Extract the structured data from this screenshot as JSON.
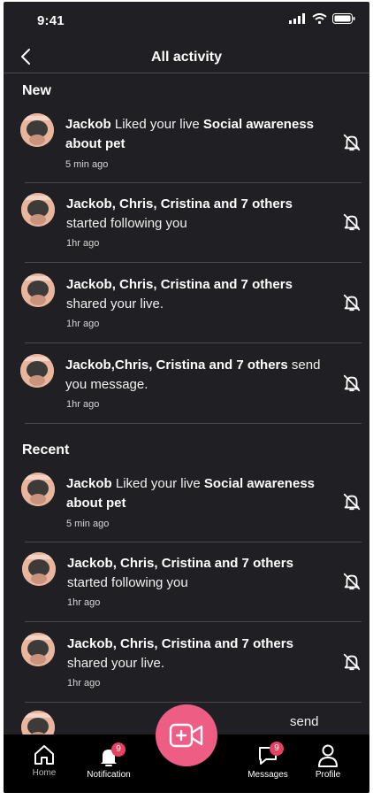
{
  "status": {
    "time": "9:41"
  },
  "header": {
    "title": "All activity"
  },
  "sections": {
    "new": "New",
    "recent": "Recent"
  },
  "items": [
    {
      "a": "Jackob",
      "b": " Liked your live ",
      "c": "Social awareness about pet",
      "d": "",
      "time": "5 min ago"
    },
    {
      "a": "Jackob, Chris, Cristina and 7 others",
      "b": " started following you",
      "c": "",
      "d": "",
      "time": "1hr ago"
    },
    {
      "a": "Jackob, Chris, Cristina and 7 others",
      "b": " shared your live.",
      "c": "",
      "d": "",
      "time": "1hr ago"
    },
    {
      "a": "Jackob,Chris, Cristina and 7 others",
      "b": " send you message.",
      "c": "",
      "d": "",
      "time": "1hr ago"
    },
    {
      "a": "Jackob",
      "b": " Liked your live ",
      "c": "Social awareness about pet",
      "d": "",
      "time": "5 min ago"
    },
    {
      "a": "Jackob, Chris, Cristina and 7 others",
      "b": " started following you",
      "c": "",
      "d": "",
      "time": "1hr ago"
    },
    {
      "a": "Jackob, Chris, Cristina and 7 others",
      "b": " shared your live.",
      "c": "",
      "d": "",
      "time": "1hr ago"
    },
    {
      "a": "",
      "b": "send",
      "c": "",
      "d": "",
      "time": ""
    }
  ],
  "tabs": {
    "home": "Home",
    "notification": "Notification",
    "notification_badge": "9",
    "messages": "Messages",
    "messages_badge": "9",
    "profile": "Profile"
  },
  "colors": {
    "background": "#1f1f24",
    "accent": "#ee5d84",
    "badge": "#e8405f"
  },
  "icons": [
    "back-icon",
    "bell-off-icon",
    "home-icon",
    "bell-icon",
    "video-plus-icon",
    "chat-icon",
    "user-icon"
  ]
}
